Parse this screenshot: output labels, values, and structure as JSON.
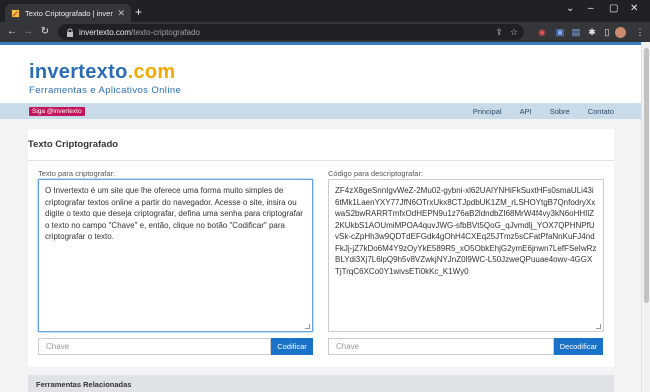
{
  "browser": {
    "tab_title": "Texto Criptografado | invertexto.c",
    "url_host": "invertexto.com",
    "url_path": "/texto-criptografado"
  },
  "site": {
    "logo_main": "invertexto",
    "logo_tld": ".com",
    "tagline": "Ferramentas e Aplicativos Online",
    "badge": "Siga @invertexto",
    "nav": [
      "Principal",
      "API",
      "Sobre",
      "Contato"
    ]
  },
  "tool": {
    "title": "Texto Criptografado",
    "left_label": "Texto para criptografar:",
    "left_text": "O Invertexto é um site que lhe oferece uma forma muito simples de criptografar textos online a partir do navegador. Acesse o site, insira ou digite o texto que deseja criptografar, defina uma senha para criptografar o texto no campo \"Chave\" e, então, clique no botão \"Codificar\" para criptografar o texto.",
    "right_label": "Código para descriptografar:",
    "right_text": "ZF4zX8geSnnIgvWeZ-2Mu02-gybni-xl62UAIYNHiFkSuxtHFs0smaULi43i6tMk1LaenYXY77JfN6OTrxUkx8CTJpdbUK1ZM_rLSHOYtgB7QnfodryXxwaS2bwRARRTmfxOdHEPN9u1z76aB2ldndbZI68MrW4f4vy3kN6oHHIlZ2KUkbS1AOUmiMPOA4quvJWG-sfbBVt5QoG_qJvmdlj_YOX7QPHNPfUvSk-cZpHh3w9QDTdEFGdk4gOhH4CXEq25JTmz5sCFatPfaNnKuFJ4ndFkJj-jZ7kDo6M4Y9zOyYkE589R5_xO5ObkEhjG2ymE6jnwn7LefFSeIwRzBLYdi3Xj7L6lpQ9h5v8VZwkjNYJnZ0l9WC-L50JzweQPuuae4owv-4GGXTjTrqC6XCo0Y1wivsETi0kKc_K1Wy0",
    "key_placeholder": "Chave",
    "encode_button": "Codificar",
    "decode_button": "Decodificar"
  },
  "related": {
    "title": "Ferramentas Relacionadas"
  }
}
